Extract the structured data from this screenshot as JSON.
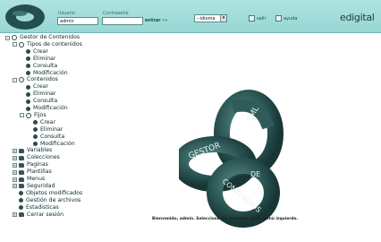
{
  "header": {
    "user_label": "Usuario",
    "user_value": "admin",
    "password_label": "Contraseña",
    "password_value": "",
    "enter_label": "entrar ›››",
    "language_value": "--idioma",
    "exit_label": "salir",
    "help_label": "ayuda",
    "brand": "edigital",
    "accent_color": "#a6ddda"
  },
  "tree": [
    {
      "label": "Gestor de Contenidos",
      "toggle": "-",
      "icon": "circle-open-icon"
    },
    {
      "label": "Tipos de contenidos",
      "toggle": "-",
      "icon": "circle-open-icon"
    },
    {
      "label": "Crear",
      "icon": "circle-filled-icon"
    },
    {
      "label": "Eliminar",
      "icon": "circle-filled-icon"
    },
    {
      "label": "Consulta",
      "icon": "circle-filled-icon"
    },
    {
      "label": "Modificación",
      "icon": "circle-filled-icon"
    },
    {
      "label": "Contenidos",
      "toggle": "-",
      "icon": "circle-open-icon"
    },
    {
      "label": "Crear",
      "icon": "circle-filled-icon"
    },
    {
      "label": "Eliminar",
      "icon": "circle-filled-icon"
    },
    {
      "label": "Consulta",
      "icon": "circle-filled-icon"
    },
    {
      "label": "Modificación",
      "icon": "circle-filled-icon"
    },
    {
      "label": "Fijos",
      "toggle": "-",
      "icon": "circle-open-icon"
    },
    {
      "label": "Crear",
      "icon": "circle-filled-icon"
    },
    {
      "label": "Eliminar",
      "icon": "circle-filled-icon"
    },
    {
      "label": "Consulta",
      "icon": "circle-filled-icon"
    },
    {
      "label": "Modificación",
      "icon": "circle-filled-icon"
    },
    {
      "label": "Variables",
      "toggle": "+",
      "icon": "folder-icon"
    },
    {
      "label": "Colecciones",
      "toggle": "+",
      "icon": "folder-icon"
    },
    {
      "label": "Paginas",
      "toggle": "+",
      "icon": "folder-icon"
    },
    {
      "label": "Plantillas",
      "toggle": "+",
      "icon": "folder-icon"
    },
    {
      "label": "Menus",
      "toggle": "+",
      "icon": "folder-icon"
    },
    {
      "label": "Seguridad",
      "toggle": "+",
      "icon": "folder-icon"
    },
    {
      "label": "Objetos modificados",
      "icon": "circle-filled-icon"
    },
    {
      "label": "Gestión de archivos",
      "icon": "circle-filled-icon"
    },
    {
      "label": "Estadisticas",
      "icon": "circle-filled-icon"
    },
    {
      "label": "Cerrar sesión",
      "toggle": "+",
      "icon": "folder-icon"
    }
  ],
  "logo": {
    "text_top": "XML",
    "text_mid": "GESTOR",
    "text_de": "DE",
    "text_bottom": "CONTENIDOS"
  },
  "welcome_text": "Bienvenido, admin. Seleccione las opciones en el menú izquierdo."
}
